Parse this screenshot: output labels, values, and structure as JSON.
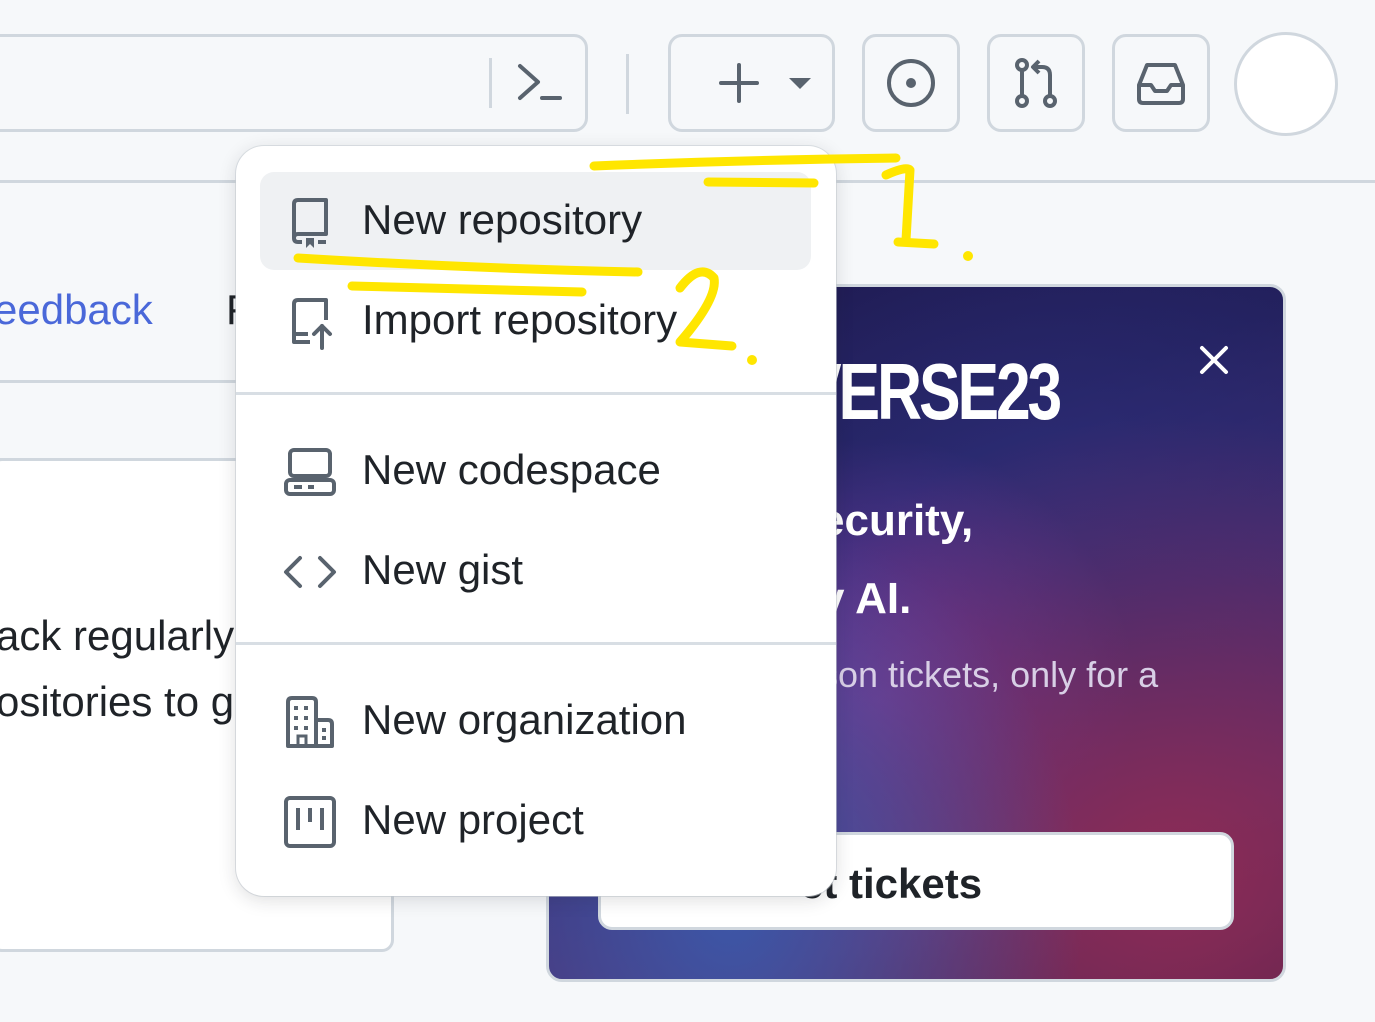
{
  "header": {
    "search_cmd_icon": "command-palette-icon",
    "create_button_icon": "plus-icon",
    "create_dropdown_icon": "triangle-down-icon",
    "issues_icon": "issue-opened-icon",
    "pull_requests_icon": "git-pull-request-icon",
    "inbox_icon": "inbox-icon"
  },
  "left": {
    "feedback_link": "eedback",
    "partial_char": "F",
    "card_line1": "ack regularly",
    "card_line2": "ositories to g"
  },
  "promo": {
    "logo": "VERSE23",
    "headline_line1": "ecurity,",
    "headline_line2": "y AI.",
    "subtext": "son tickets, only for a",
    "button_label": "et tickets",
    "close_icon": "x-icon"
  },
  "menu": {
    "groups": [
      [
        {
          "label": "New repository",
          "icon": "repo-icon"
        },
        {
          "label": "Import repository",
          "icon": "repo-push-icon"
        }
      ],
      [
        {
          "label": "New codespace",
          "icon": "codespaces-icon"
        },
        {
          "label": "New gist",
          "icon": "code-icon"
        }
      ],
      [
        {
          "label": "New organization",
          "icon": "organization-icon"
        },
        {
          "label": "New project",
          "icon": "project-icon"
        }
      ]
    ]
  },
  "annotations": {
    "step1": "1.",
    "step2": "2.",
    "color": "#ffe600"
  },
  "colors": {
    "link": "#4a68d9",
    "border": "#d0d7de",
    "text": "#1f2328"
  }
}
